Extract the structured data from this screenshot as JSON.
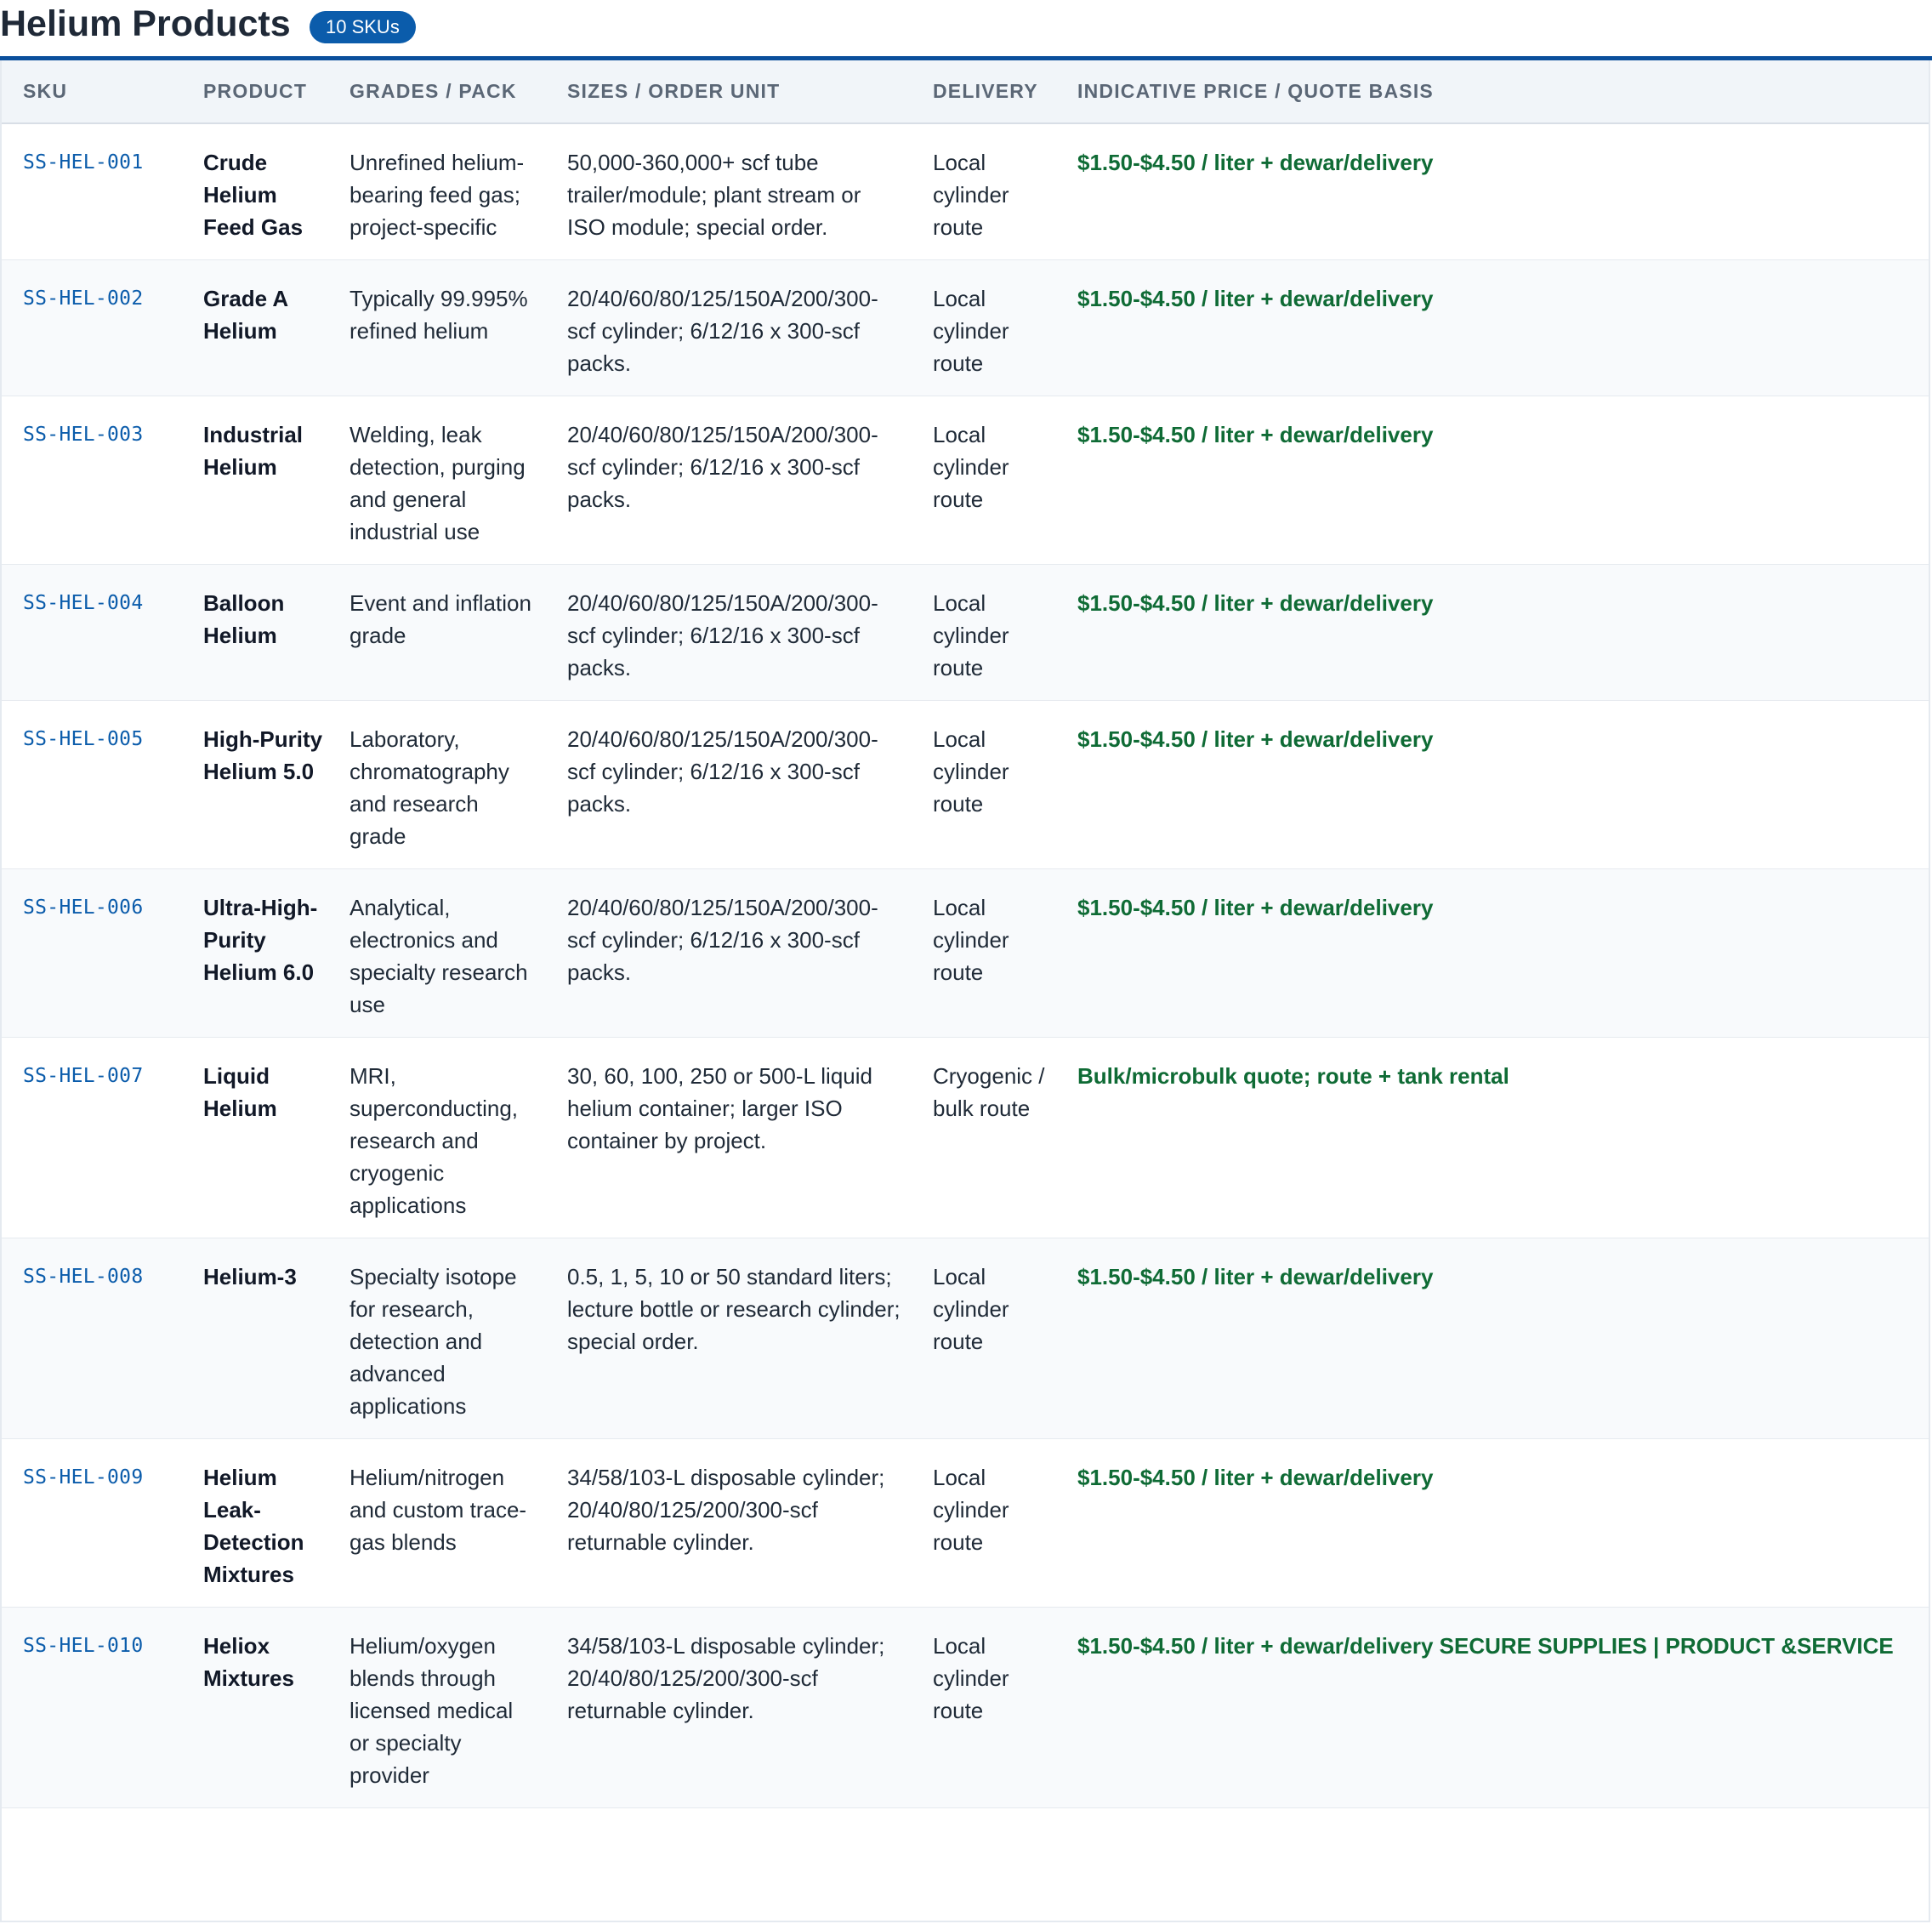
{
  "header": {
    "title": "Helium Products",
    "badge": "10 SKUs"
  },
  "table": {
    "columns": [
      "SKU",
      "PRODUCT",
      "GRADES / PACK",
      "SIZES / ORDER UNIT",
      "DELIVERY",
      "INDICATIVE PRICE / QUOTE BASIS"
    ],
    "rows": [
      {
        "sku": "SS-HEL-001",
        "product": "Crude Helium Feed Gas",
        "grade": "Unrefined helium-bearing feed gas; project-specific",
        "size": "50,000-360,000+ scf tube trailer/module; plant stream or ISO module; special order.",
        "delivery": "Local cylinder route",
        "price": "$1.50-$4.50 / liter + dewar/delivery"
      },
      {
        "sku": "SS-HEL-002",
        "product": "Grade A Helium",
        "grade": "Typically 99.995% refined helium",
        "size": "20/40/60/80/125/150A/200/300-scf cylinder; 6/12/16 x 300-scf packs.",
        "delivery": "Local cylinder route",
        "price": "$1.50-$4.50 / liter + dewar/delivery"
      },
      {
        "sku": "SS-HEL-003",
        "product": "Industrial Helium",
        "grade": "Welding, leak detection, purging and general industrial use",
        "size": "20/40/60/80/125/150A/200/300-scf cylinder; 6/12/16 x 300-scf packs.",
        "delivery": "Local cylinder route",
        "price": "$1.50-$4.50 / liter + dewar/delivery"
      },
      {
        "sku": "SS-HEL-004",
        "product": "Balloon Helium",
        "grade": "Event and inflation grade",
        "size": "20/40/60/80/125/150A/200/300-scf cylinder; 6/12/16 x 300-scf packs.",
        "delivery": "Local cylinder route",
        "price": "$1.50-$4.50 / liter + dewar/delivery"
      },
      {
        "sku": "SS-HEL-005",
        "product": "High-Purity Helium 5.0",
        "grade": "Laboratory, chromatography and research grade",
        "size": "20/40/60/80/125/150A/200/300-scf cylinder; 6/12/16 x 300-scf packs.",
        "delivery": "Local cylinder route",
        "price": "$1.50-$4.50 / liter + dewar/delivery"
      },
      {
        "sku": "SS-HEL-006",
        "product": "Ultra-High-Purity Helium 6.0",
        "grade": "Analytical, electronics and specialty research use",
        "size": "20/40/60/80/125/150A/200/300-scf cylinder; 6/12/16 x 300-scf packs.",
        "delivery": "Local cylinder route",
        "price": "$1.50-$4.50 / liter + dewar/delivery"
      },
      {
        "sku": "SS-HEL-007",
        "product": "Liquid Helium",
        "grade": "MRI, superconducting, research and cryogenic applications",
        "size": "30, 60, 100, 250 or 500-L liquid helium container; larger ISO container by project.",
        "delivery": "Cryogenic / bulk route",
        "price": "Bulk/microbulk quote; route + tank rental"
      },
      {
        "sku": "SS-HEL-008",
        "product": "Helium-3",
        "grade": "Specialty isotope for research, detection and advanced applications",
        "size": "0.5, 1, 5, 10 or 50 standard liters; lecture bottle or research cylinder; special order.",
        "delivery": "Local cylinder route",
        "price": "$1.50-$4.50 / liter + dewar/delivery"
      },
      {
        "sku": "SS-HEL-009",
        "product": "Helium Leak-Detection Mixtures",
        "grade": "Helium/nitrogen and custom trace-gas blends",
        "size": "34/58/103-L disposable cylinder; 20/40/80/125/200/300-scf returnable cylinder.",
        "delivery": "Local cylinder route",
        "price": "$1.50-$4.50 / liter + dewar/delivery"
      },
      {
        "sku": "SS-HEL-010",
        "product": "Heliox Mixtures",
        "grade": "Helium/oxygen blends through licensed medical or specialty provider",
        "size": "34/58/103-L disposable cylinder; 20/40/80/125/200/300-scf returnable cylinder.",
        "delivery": "Local cylinder route",
        "price": "$1.50-$4.50 / liter + dewar/delivery SECURE SUPPLIES | PRODUCT &SERVICE"
      }
    ]
  }
}
